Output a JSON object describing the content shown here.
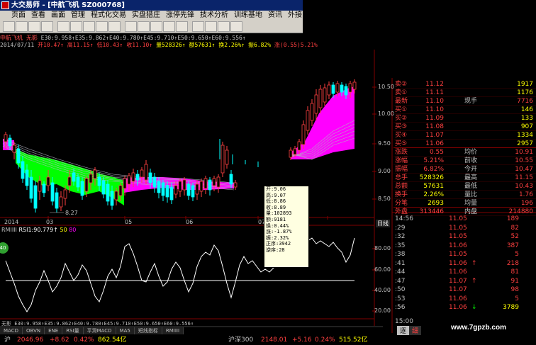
{
  "titlebar": {
    "title": "大交易师 - [中航飞机 SZ000768]"
  },
  "menu": [
    "页面",
    "查看",
    "画面",
    "管理",
    "程式化交易",
    "实盘猎庄",
    "涨停先锋",
    "技术分析",
    "训练基地",
    "资讯",
    "外接"
  ],
  "toolbar_icons": [
    "back",
    "forward",
    "home",
    "refresh",
    "list",
    "chart",
    "kline",
    "minute",
    "zoom-in",
    "zoom-out",
    "indicator",
    "draw",
    "calc",
    "f10",
    "alert",
    "news",
    "settings",
    "window"
  ],
  "info1": {
    "name": "中航飞机 无影",
    "ma_values": "E30:9.958↑E35:9.862↑E40:9.780↑E45:9.710↑E50:9.650↑E60:9.556↑",
    "name_color": "#ff5050"
  },
  "info2": {
    "date": "2014/07/11",
    "open": "开10.47↑",
    "high": "高11.15↑",
    "low": "低10.43↑",
    "close": "收11.10↑",
    "vol": "量528326↑",
    "amt": "额57631↑",
    "turn": "换2.26%↑",
    "amp": "振6.82%",
    "chg": "涨(0.55)5.21%"
  },
  "price_axis": [
    "10.50",
    "10.00",
    "9.50",
    "9.00",
    "8.50"
  ],
  "date_axis": [
    "2014",
    "03",
    "05",
    "06",
    "07"
  ],
  "low_label": "8.27",
  "rsi_header": {
    "name": "RMIIII",
    "rsi": "RSI1:90.779↑",
    "l50": "50",
    "l80": "80"
  },
  "rsi_axis": [
    "80.00",
    "60.00",
    "40.00",
    "20.00"
  ],
  "right_tab": "日线",
  "tooltip": [
    "开:9.06",
    "高:9.07",
    "低:8.86",
    "收:8.89",
    "量:102893",
    "额:9181",
    "换:0.44%",
    "涨:-1.87%",
    "振:2.32%",
    "正序:3942",
    "逆序:28"
  ],
  "quotes": [
    {
      "label": "卖②",
      "price": "11.12",
      "vol": "1917",
      "pc": "#ff4040"
    },
    {
      "label": "卖①",
      "price": "11.11",
      "vol": "1176",
      "pc": "#ff4040"
    },
    {
      "label": "最新",
      "price": "11.10",
      "extra": "现手",
      "vol": "7716",
      "pc": "#ff4040"
    },
    {
      "label": "买①",
      "price": "11.10",
      "vol": "146",
      "pc": "#ff4040"
    },
    {
      "label": "买②",
      "price": "11.09",
      "vol": "133",
      "pc": "#ff4040"
    },
    {
      "label": "买③",
      "price": "11.08",
      "vol": "907",
      "pc": "#ff4040"
    },
    {
      "label": "买④",
      "price": "11.07",
      "vol": "1334",
      "pc": "#ff4040"
    },
    {
      "label": "买⑤",
      "price": "11.06",
      "vol": "2957",
      "pc": "#ff4040"
    },
    {
      "label": "涨跌",
      "price": "0.55",
      "extra": "均价",
      "vol": "10.91",
      "pc": "#ff4040"
    },
    {
      "label": "涨幅",
      "price": "5.21%",
      "extra": "前收",
      "vol": "10.55",
      "pc": "#ff4040"
    },
    {
      "label": "振幅",
      "price": "6.82%",
      "extra": "今开",
      "vol": "10.47",
      "pc": "#ff4040"
    },
    {
      "label": "总手",
      "price": "528326",
      "extra": "最高",
      "vol": "11.15",
      "pc": "#ffff00"
    },
    {
      "label": "总额",
      "price": "57631",
      "extra": "最低",
      "vol": "10.43",
      "pc": "#ffff00"
    },
    {
      "label": "换手",
      "price": "2.26%",
      "extra": "量比",
      "vol": "1.76",
      "pc": "#ffff00"
    },
    {
      "label": "分笔",
      "price": "2693",
      "extra": "均量",
      "vol": "196",
      "pc": "#ffff00"
    },
    {
      "label": "外盘",
      "price": "313446",
      "extra": "内盘",
      "vol": "214880",
      "pc": "#ff4040"
    }
  ],
  "ticks": [
    {
      "time": "14:56",
      "price": "11.05",
      "arrow": "",
      "vol": "189"
    },
    {
      "time": ":29",
      "price": "11.05",
      "arrow": "",
      "vol": "82"
    },
    {
      "time": ":32",
      "price": "11.05",
      "arrow": "",
      "vol": "52"
    },
    {
      "time": ":35",
      "price": "11.06",
      "arrow": "",
      "vol": "387"
    },
    {
      "time": ":38",
      "price": "11.05",
      "arrow": "",
      "vol": "5"
    },
    {
      "time": ":41",
      "price": "11.06",
      "arrow": "↑",
      "vol": "218"
    },
    {
      "time": ":44",
      "price": "11.06",
      "arrow": "",
      "vol": "81"
    },
    {
      "time": ":47",
      "price": "11.07",
      "arrow": "↑",
      "vol": "91"
    },
    {
      "time": ":50",
      "price": "11.07",
      "arrow": "",
      "vol": "98"
    },
    {
      "time": ":53",
      "price": "11.06",
      "arrow": "",
      "vol": "5"
    },
    {
      "time": ":56",
      "price": "11.06",
      "arrow": "↓",
      "vol": "3789"
    },
    {
      "time": "15:00",
      "price": "",
      "arrow": "",
      "vol": ""
    }
  ],
  "bottom_label": "无影",
  "bottom_ma": "E30:9.958↑E35:9.862↑E40:9.780↑E45:9.710↑E50:9.650↑E60:9.556↑",
  "tabs": [
    "MACD",
    "OBVN",
    "ENE",
    "RSI量",
    "平滑MACD",
    "MA5",
    "短线指标",
    "RMIIII"
  ],
  "right_bottom_tabs": [
    "逐",
    "细"
  ],
  "status": {
    "sh_label": "沪",
    "sh_value": "2046.96",
    "sh_chg": "+8.62",
    "sh_pct": "0.42%",
    "sh_amt": "862.54亿",
    "hs_label": "沪深300",
    "hs_value": "2148.01",
    "hs_chg": "+5.16",
    "hs_pct": "0.24%",
    "hs_amt": "515.52亿"
  },
  "watermark": "www.7gpzb.com",
  "colors": {
    "up": "#ff4040",
    "down": "#00ff00",
    "ma_magenta": "#ff00ff",
    "bg": "#000000",
    "axis": "#800000"
  }
}
